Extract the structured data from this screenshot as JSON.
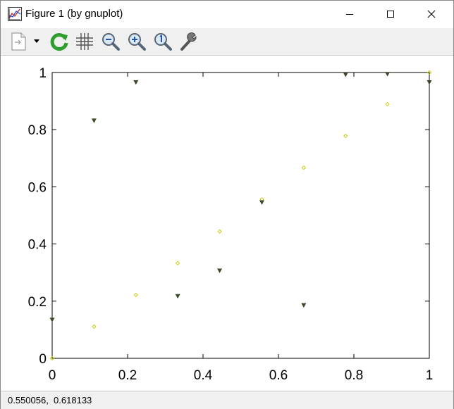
{
  "window": {
    "title": "Figure 1 (by gnuplot)"
  },
  "toolbar": {
    "items": [
      {
        "name": "export-icon"
      },
      {
        "name": "dropdown-arrow-icon"
      },
      {
        "name": "replot-icon",
        "color": "#2e9e2e"
      },
      {
        "name": "grid-icon"
      },
      {
        "name": "zoom-out-icon"
      },
      {
        "name": "zoom-in-icon"
      },
      {
        "name": "zoom-reset-icon"
      },
      {
        "name": "settings-wrench-icon"
      }
    ]
  },
  "status": {
    "coordinates": "0.550056,  0.618133"
  },
  "chart_data": {
    "type": "scatter",
    "xlim": [
      0,
      1
    ],
    "ylim": [
      0,
      1
    ],
    "x_ticks": [
      "0",
      "0.2",
      "0.4",
      "0.6",
      "0.8",
      "1"
    ],
    "y_ticks": [
      "0",
      "0.2",
      "0.4",
      "0.6",
      "0.8",
      "1"
    ],
    "x_tick_values": [
      0,
      0.2,
      0.4,
      0.6,
      0.8,
      1
    ],
    "y_tick_values": [
      0,
      0.2,
      0.4,
      0.6,
      0.8,
      1
    ],
    "grid": false,
    "series": [
      {
        "marker": "diamond",
        "color": "#c8c800",
        "x": [
          0,
          0.111,
          0.222,
          0.333,
          0.444,
          0.556,
          0.667,
          0.778,
          0.889,
          1.0
        ],
        "y": [
          0,
          0.111,
          0.222,
          0.333,
          0.444,
          0.556,
          0.667,
          0.778,
          0.889,
          1.0
        ]
      },
      {
        "marker": "triangle-down",
        "color": "#3a4a2a",
        "x": [
          0,
          0.111,
          0.222,
          0.333,
          0.444,
          0.556,
          0.667,
          0.778,
          0.889,
          1.0
        ],
        "y": [
          0.135,
          0.832,
          0.966,
          0.218,
          0.307,
          0.546,
          0.186,
          0.993,
          0.995,
          0.966
        ]
      }
    ]
  }
}
